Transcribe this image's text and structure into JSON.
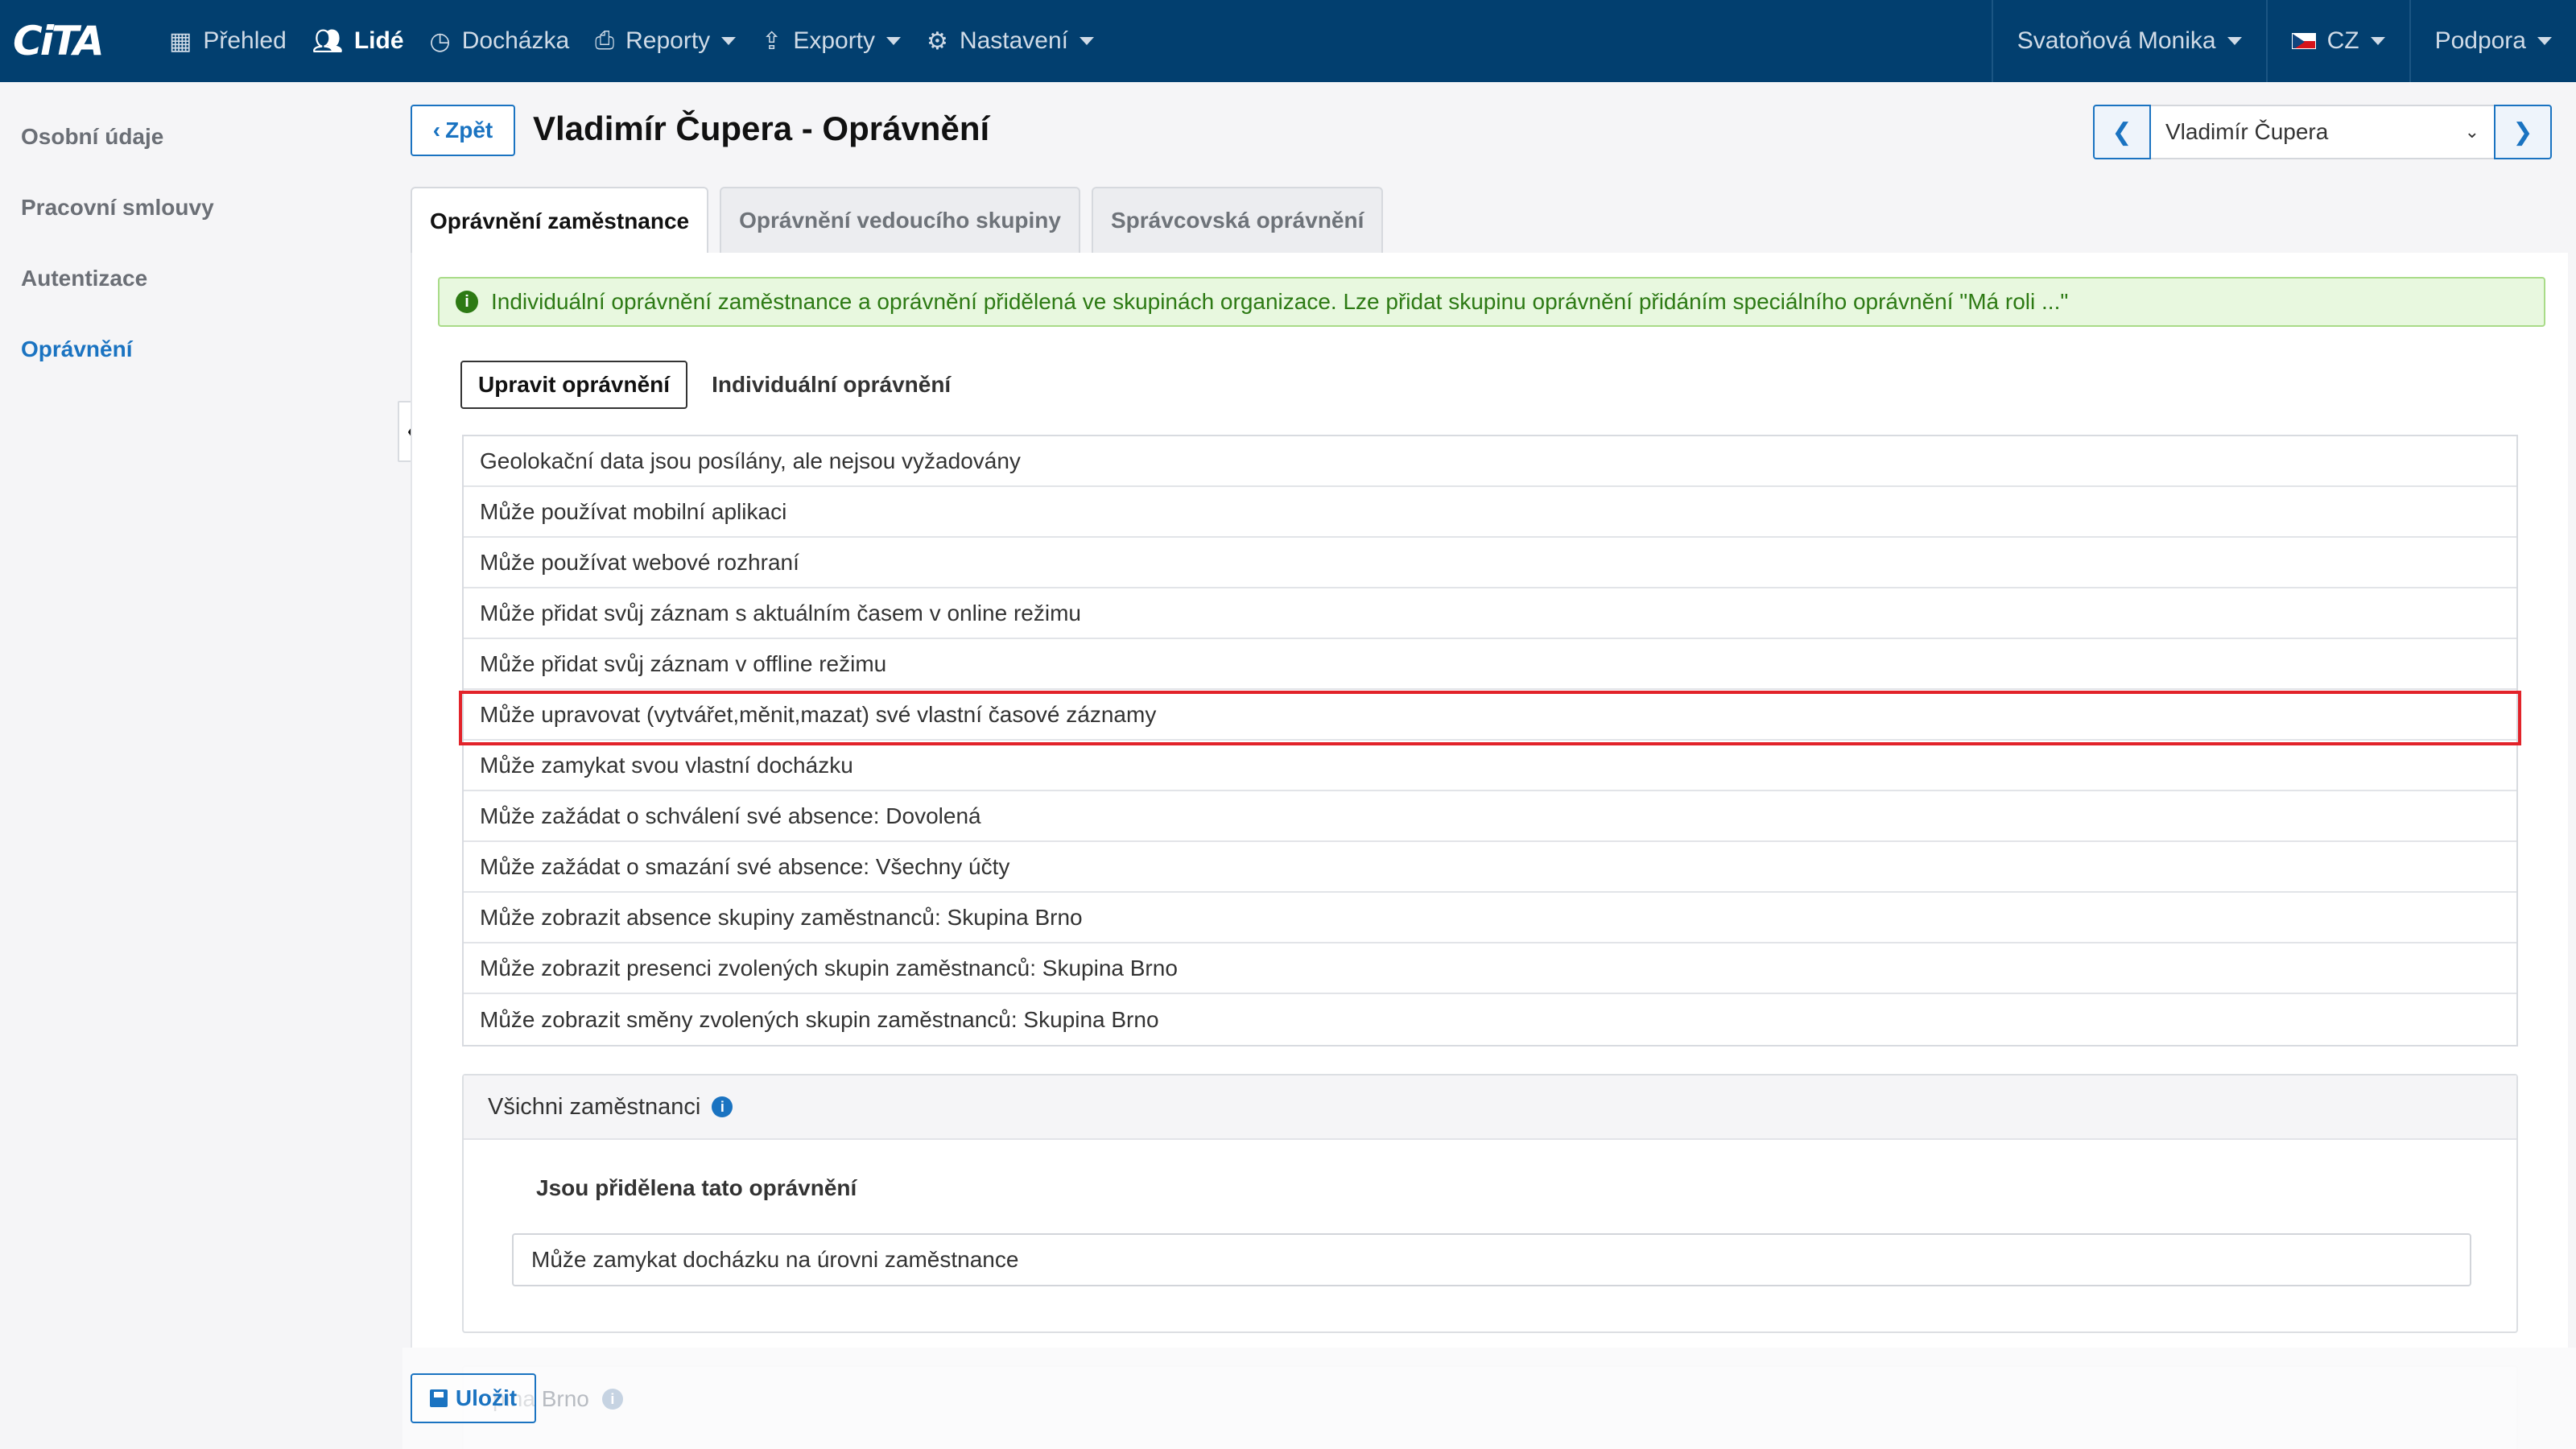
{
  "navbar": {
    "logo_text": "CiTA",
    "items": [
      {
        "label": "Přehled",
        "icon": "grid-icon"
      },
      {
        "label": "Lidé",
        "icon": "users-icon"
      },
      {
        "label": "Docházka",
        "icon": "clock-icon"
      },
      {
        "label": "Reporty",
        "icon": "print-icon"
      },
      {
        "label": "Exporty",
        "icon": "export-icon"
      },
      {
        "label": "Nastavení",
        "icon": "gear-icon"
      }
    ],
    "user": "Svatoňová Monika",
    "language": "CZ",
    "support": "Podpora"
  },
  "sidebar": {
    "items": [
      {
        "label": "Osobní údaje"
      },
      {
        "label": "Pracovní smlouvy"
      },
      {
        "label": "Autentizace"
      },
      {
        "label": "Oprávnění"
      }
    ]
  },
  "header": {
    "back_label": "Zpět",
    "title": "Vladimír Čupera - Oprávnění",
    "employee_selected": "Vladimír Čupera"
  },
  "tabs": [
    {
      "label": "Oprávnění zaměstnance"
    },
    {
      "label": "Oprávnění vedoucího skupiny"
    },
    {
      "label": "Správcovská oprávnění"
    }
  ],
  "alert": {
    "text": "Individuální oprávnění zaměstnance a oprávnění přidělená ve skupinách organizace. Lze přidat skupinu oprávnění přidáním speciálního oprávnění \"Má roli ...\""
  },
  "subtabs": {
    "edit": "Upravit oprávnění",
    "individual": "Individuální oprávnění"
  },
  "permissions": [
    "Geolokační data jsou posílány, ale nejsou vyžadovány",
    "Může používat mobilní aplikaci",
    "Může používat webové rozhraní",
    "Může přidat svůj záznam s aktuálním časem v online režimu",
    "Může přidat svůj záznam v offline režimu",
    "Může upravovat (vytvářet,měnit,mazat) své vlastní časové záznamy",
    "Může zamykat svou vlastní docházku",
    "Může zažádat o schválení své absence: Dovolená",
    "Může zažádat o smazání své absence: Všechny účty",
    "Může zobrazit absence skupiny zaměstnanců: Skupina Brno",
    "Může zobrazit presenci zvolených skupin zaměstnanců: Skupina Brno",
    "Může zobrazit směny zvolených skupin zaměstnanců: Skupina Brno"
  ],
  "group_panel": {
    "title": "Všichni zaměstnanci",
    "subtitle": "Jsou přidělena tato oprávnění",
    "assigned": "Může zamykat docházku na úrovni zaměstnance"
  },
  "next_group_partial": "pina Brno",
  "save_label": "Uložit",
  "colors": {
    "navbar": "#023f6f",
    "accent": "#1a73c1",
    "alert_bg": "#e8f8df",
    "alert_text": "#2d7a14",
    "highlight": "#e2232a"
  }
}
